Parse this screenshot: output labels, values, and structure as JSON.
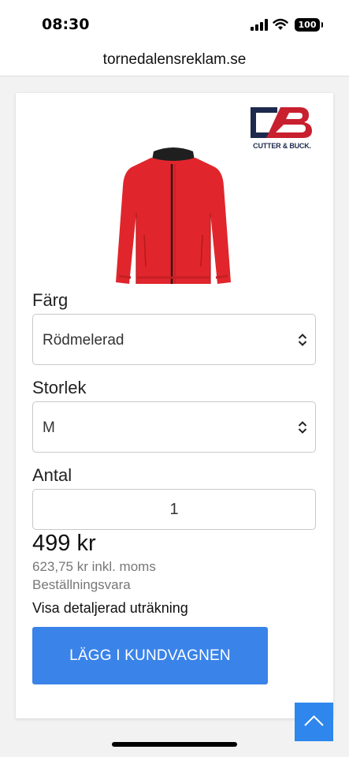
{
  "status_bar": {
    "time": "08:30",
    "battery": "100"
  },
  "browser": {
    "url": "tornedalensreklam.se"
  },
  "brand": {
    "logo_text": "CUTTER & BUCK."
  },
  "product": {
    "color": {
      "label": "Färg",
      "value": "Rödmelerad"
    },
    "size": {
      "label": "Storlek",
      "value": "M"
    },
    "quantity": {
      "label": "Antal",
      "value": "1"
    },
    "price": "499 kr",
    "price_incl_vat": "623,75 kr inkl. moms",
    "availability": "Beställningsvara",
    "details_link": "Visa detaljerad uträkning",
    "add_to_cart": "LÄGG I KUNDVAGNEN"
  },
  "colors": {
    "button_blue": "#3a83e9",
    "scroll_top_blue": "#2f86ec",
    "jacket_red": "#e0262c",
    "logo_navy": "#1d2a4d",
    "logo_red": "#c8202f"
  },
  "icons": {
    "signal": "signal-icon",
    "wifi": "wifi-icon",
    "battery": "battery-icon",
    "select_arrows": "chevron-up-down-icon",
    "scroll_top": "chevron-up-icon"
  }
}
